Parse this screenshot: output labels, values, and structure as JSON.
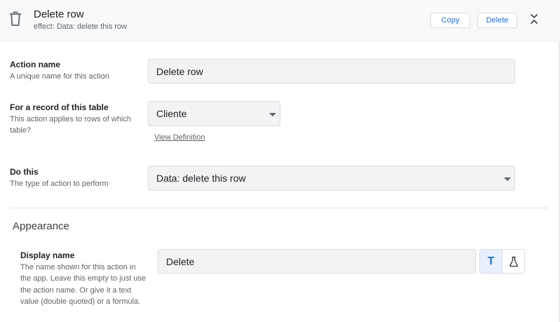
{
  "header": {
    "title": "Delete row",
    "subtitle_prefix": "effect:",
    "subtitle_value": "Data: delete this row",
    "copy_label": "Copy",
    "delete_label": "Delete"
  },
  "action_name": {
    "label": "Action name",
    "description": "A unique name for this action",
    "value": "Delete row"
  },
  "table": {
    "label": "For a record of this table",
    "description": "This action applies to rows of which table?",
    "value": "Cliente",
    "link": "View Definition"
  },
  "do_this": {
    "label": "Do this",
    "description": "The type of action to perform",
    "value": "Data: delete this row"
  },
  "appearance": {
    "title": "Appearance",
    "display_name": {
      "label": "Display name",
      "description": "The name shown for this action in the app. Leave this empty to just use the action name. Or give it a text value (double quoted) or a formula.",
      "value": "Delete",
      "text_button": "T"
    }
  },
  "colors": {
    "accent": "#1a73e8",
    "header_bg": "#f8f9fa",
    "field_bg": "#f1f3f4",
    "active_toggle_bg": "#e8f0fe"
  },
  "icons": [
    "trash-icon",
    "collapse-icon",
    "dropdown-caret-icon",
    "flask-icon"
  ]
}
